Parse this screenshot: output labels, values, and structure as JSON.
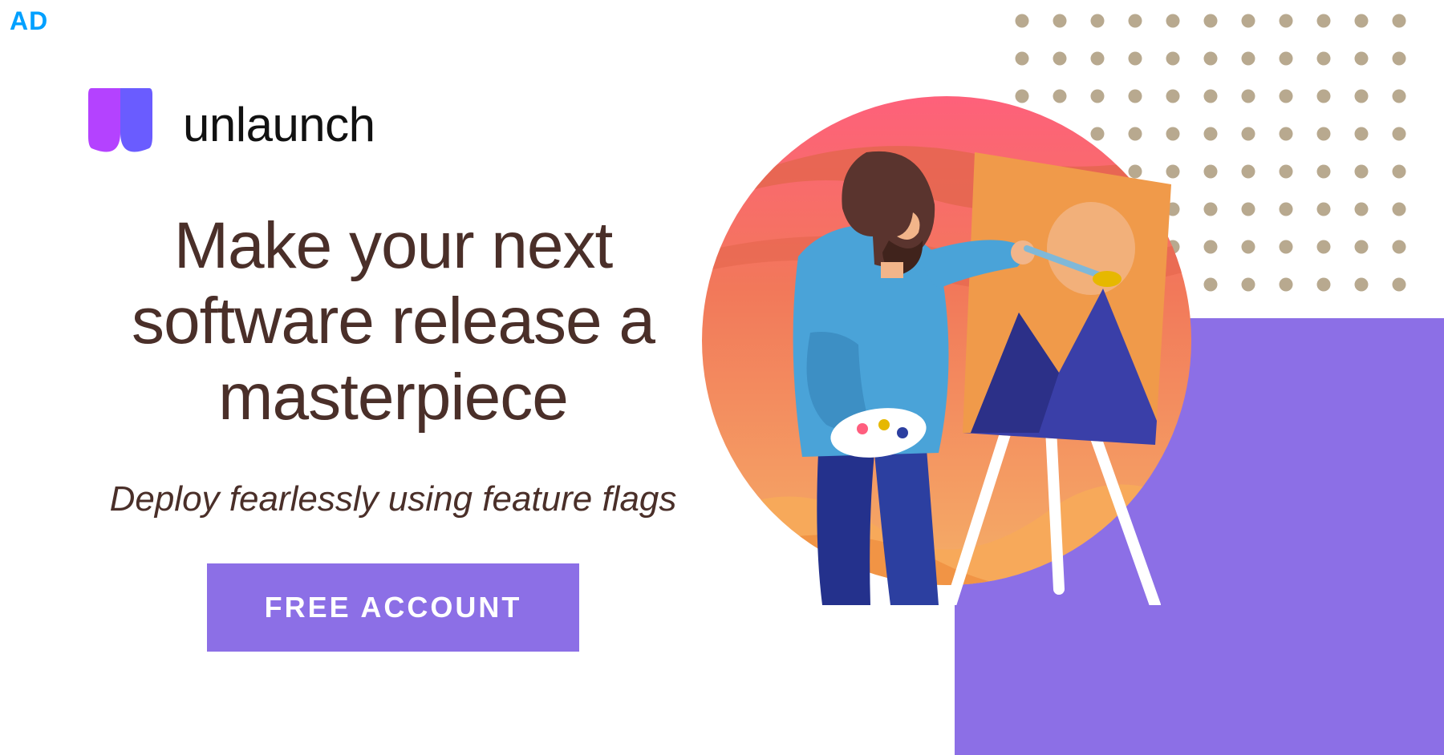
{
  "ad_label": "AD",
  "brand": {
    "name": "unlaunch",
    "logo_colors": {
      "left": "#b442ff",
      "right": "#6a5cff"
    }
  },
  "headline": "Make your next software release a masterpiece",
  "subtitle": "Deploy fearlessly using feature flags",
  "cta": {
    "label": "FREE ACCOUNT"
  },
  "colors": {
    "accent": "#8c6fe6",
    "text_dark": "#4a2f29",
    "dot": "#b8a98f",
    "ad_blue": "#00a0ff"
  },
  "illustration": {
    "description": "painter-at-easel",
    "bg_gradient": [
      "#f2896a",
      "#ff5e7e"
    ],
    "shirt": "#4aa3d8",
    "pants": "#2c3fa0",
    "hair": "#5a342e",
    "easel_canvas": "#f09a4a",
    "easel_shape": "#3a3fa8",
    "sun": "#f2b07a",
    "brush_tip": "#e6b800"
  },
  "dot_grid": {
    "rows": 8,
    "cols": 11
  }
}
